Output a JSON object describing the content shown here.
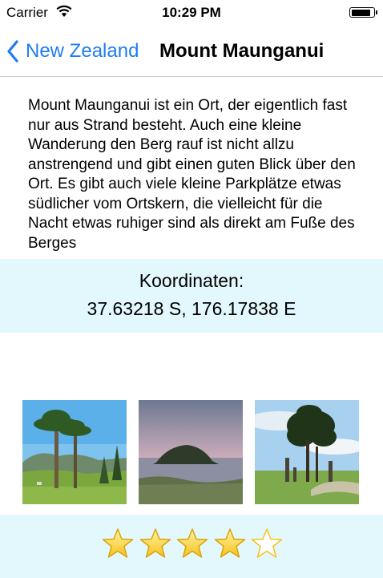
{
  "status_bar": {
    "carrier": "Carrier",
    "time": "10:29 PM",
    "battery_level": 0.9
  },
  "nav": {
    "back_label": "New Zealand",
    "title": "Mount Maunganui",
    "accent_color": "#1f7cf4"
  },
  "description": "Mount Maunganui ist ein Ort, der eigentlich fast nur aus Strand besteht. Auch eine kleine Wanderung den Berg rauf ist nicht allzu anstrengend und gibt einen guten Blick über den Ort. Es gibt auch viele kleine Parkplätze etwas südlicher vom Ortskern, die vielleicht für die Nacht etwas ruhiger sind als direkt am Fuße des Berges",
  "coordinates": {
    "label": "Koordinaten:",
    "value": "37.63218 S, 176.17838 E"
  },
  "photos": [
    {
      "subject": "palm trees on grassy park with hills"
    },
    {
      "subject": "island at dusk over water"
    },
    {
      "subject": "tree and posts on grass under cloudy sky"
    }
  ],
  "rating": {
    "value": 4,
    "max": 5,
    "filled_color": "#f7c21a",
    "empty_color": "#f7c21a"
  },
  "colors": {
    "panel_background": "#e3f8fc"
  }
}
